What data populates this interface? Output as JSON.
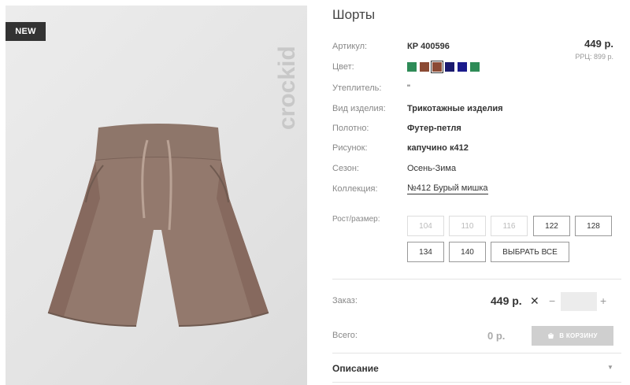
{
  "product": {
    "badge": "NEW",
    "brand": "crockid",
    "title": "Шорты",
    "price": "449 р.",
    "rrp": "РРЦ: 899 р."
  },
  "attributes": [
    {
      "label": "Артикул:",
      "value": "КР 400596"
    },
    {
      "label": "Цвет:",
      "value": ""
    },
    {
      "label": "Утеплитель:",
      "value": "\""
    },
    {
      "label": "Вид изделия:",
      "value": "Трикотажные изделия"
    },
    {
      "label": "Полотно:",
      "value": "Футер-петля"
    },
    {
      "label": "Рисунок:",
      "value": "капучино к412"
    },
    {
      "label": "Сезон:",
      "value": "Осень-Зима"
    },
    {
      "label": "Коллекция:",
      "value": "№412 Бурый мишка"
    }
  ],
  "colors": [
    "#2e8b57",
    "#8b4a34",
    "#8b4a34",
    "#1a1a6e",
    "#1a1a8c",
    "#2e8b57"
  ],
  "selected_color_index": 2,
  "sizes": {
    "label": "Рост/размер:",
    "items": [
      {
        "label": "104",
        "enabled": false
      },
      {
        "label": "110",
        "enabled": false
      },
      {
        "label": "116",
        "enabled": false
      },
      {
        "label": "122",
        "enabled": true
      },
      {
        "label": "128",
        "enabled": true
      },
      {
        "label": "134",
        "enabled": true
      },
      {
        "label": "140",
        "enabled": true
      }
    ],
    "select_all": "ВЫБРАТЬ ВСЕ"
  },
  "order": {
    "label": "Заказ:",
    "price": "449 р.",
    "times": "✕",
    "minus": "−",
    "plus": "+",
    "qty": ""
  },
  "total": {
    "label": "Всего:",
    "value": "0 р.",
    "cart_button": "В КОРЗИНУ"
  },
  "description": {
    "label": "Описание",
    "chevron": "▼"
  }
}
